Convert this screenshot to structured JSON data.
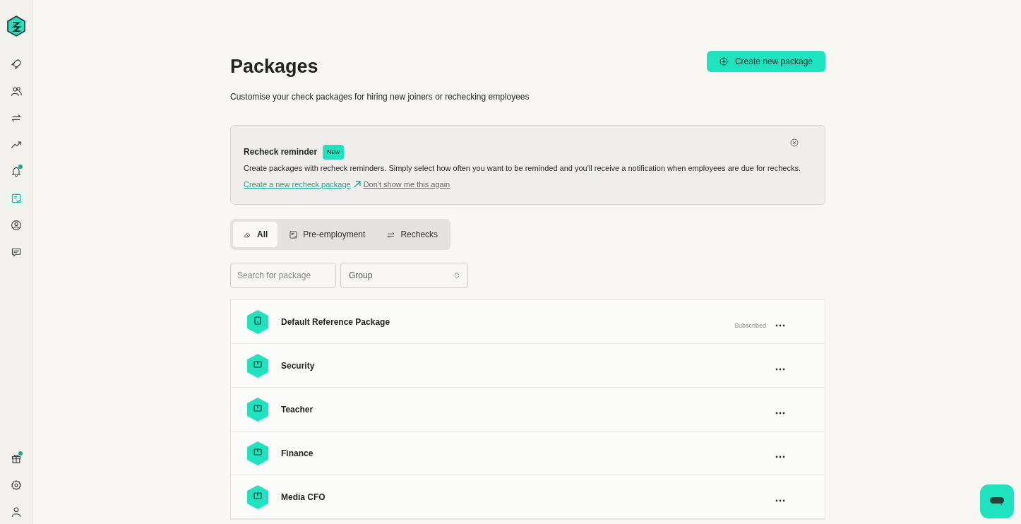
{
  "sidebar": {
    "top_items": [
      {
        "selected": false,
        "dot": false
      },
      {
        "selected": false,
        "dot": false
      },
      {
        "selected": false,
        "dot": false
      },
      {
        "selected": false,
        "dot": false
      },
      {
        "selected": false,
        "dot": true
      },
      {
        "selected": true,
        "dot": false
      },
      {
        "selected": false,
        "dot": false
      },
      {
        "selected": false,
        "dot": false
      }
    ],
    "bottom_items": [
      {
        "selected": false,
        "dot": true
      },
      {
        "selected": false,
        "dot": false
      },
      {
        "selected": false,
        "dot": false
      }
    ]
  },
  "page": {
    "title": "Packages",
    "subtitle": "Customise your check packages for hiring new joiners or rechecking employees",
    "create_button": "Create new package"
  },
  "banner": {
    "title": "Recheck reminder",
    "badge": "New",
    "text": "Create packages with recheck reminders. Simply select how often you want to be reminded and you'll receive a notification when employees are due for rechecks.",
    "link": "Create a new recheck package",
    "dismiss": "Don't show me this again"
  },
  "tabs": [
    {
      "label": "All",
      "selected": true
    },
    {
      "label": "Pre-employment",
      "selected": false
    },
    {
      "label": "Rechecks",
      "selected": false
    }
  ],
  "search": {
    "placeholder": "Search for package"
  },
  "group_select": {
    "value": "Group"
  },
  "packages": [
    {
      "name": "Default Reference Package",
      "status": "Subscribed"
    },
    {
      "name": "Security"
    },
    {
      "name": "Teacher"
    },
    {
      "name": "Finance"
    },
    {
      "name": "Media CFO"
    }
  ]
}
